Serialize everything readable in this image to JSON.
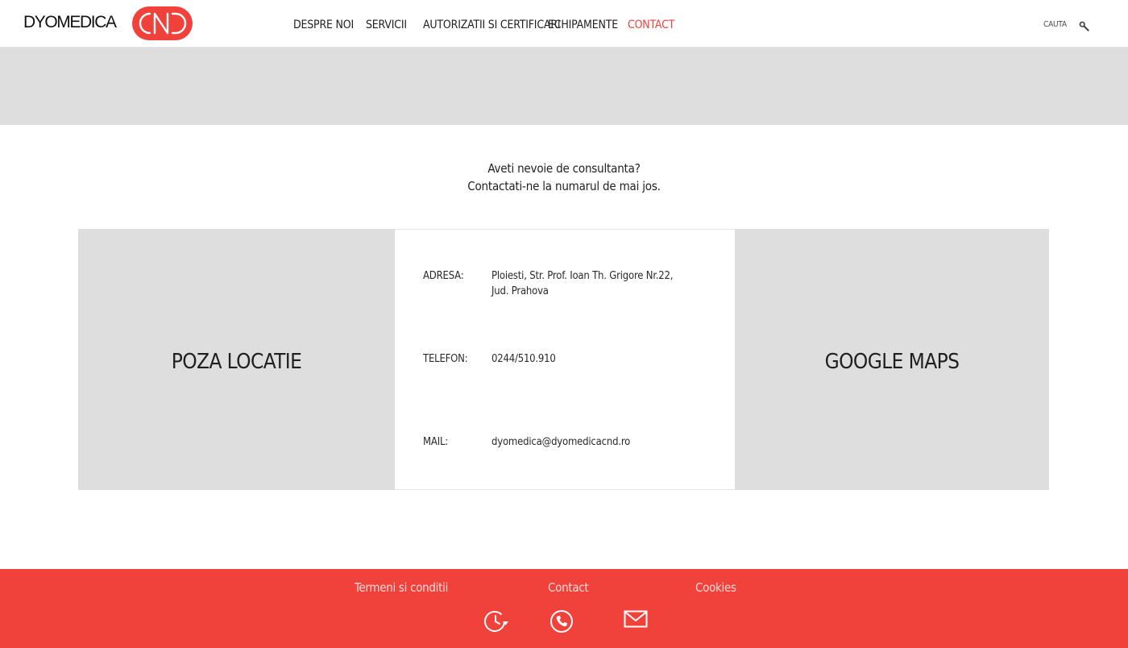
{
  "header": {
    "logo_text": "DYOMEDICA",
    "logo_badge_text": "CND",
    "nav": [
      {
        "label": "DESPRE NOI",
        "active": false
      },
      {
        "label": "SERVICII",
        "active": false
      },
      {
        "label": "AUTORIZATII SI CERTIFICARI",
        "active": false
      },
      {
        "label": "ECHIPAMENTE",
        "active": false
      },
      {
        "label": "CONTACT",
        "active": true
      }
    ],
    "search_label": "CAUTA",
    "search_icon": "magnifier-icon"
  },
  "intro": {
    "line1": "Aveti nevoie de consultanta?",
    "line2": "Contactati-ne la numarul de mai jos."
  },
  "photo_panel": {
    "caption": "POZA LOCATIE"
  },
  "contact_info": {
    "address_label": "ADRESA:",
    "address_line1": "Ploiesti, Str. Prof. Ioan Th. Grigore Nr.22,",
    "address_line2": "Jud. Prahova",
    "phone_label": "TELEFON:",
    "phone_value": "0244/510.910",
    "mail_label": "MAIL:",
    "mail_value": "dyomedica@dyomedicacnd.ro"
  },
  "map_panel": {
    "caption": "GOOGLE MAPS"
  },
  "footer": {
    "links": [
      "Termeni si conditii",
      "Contact",
      "Cookies"
    ],
    "icons": [
      "clock-icon",
      "phone-icon",
      "envelope-icon"
    ]
  },
  "colors": {
    "brand_red": "#f0413b",
    "panel_gray": "#dedede",
    "text_dark": "#1f1f1f"
  }
}
